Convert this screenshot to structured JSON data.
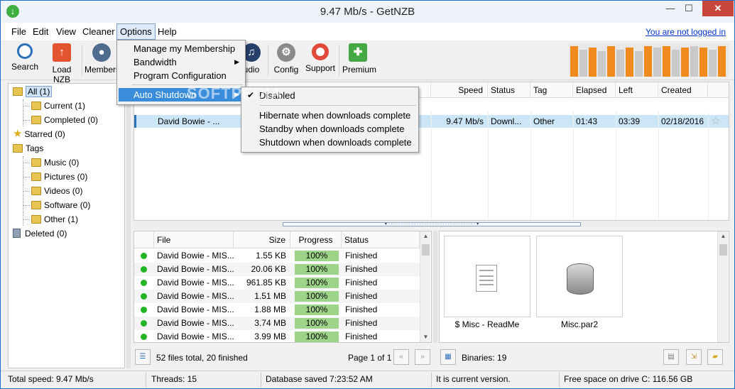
{
  "window": {
    "title": "9.47 Mb/s - GetNZB",
    "colors": {
      "titlebar": "#eef3fa",
      "close": "#c7463c",
      "accent": "#3a8ddb"
    }
  },
  "menubar": {
    "items": [
      "File",
      "Edit",
      "View",
      "Cleaner",
      "Options",
      "Help"
    ],
    "login_link": "You are not logged in"
  },
  "toolbar": {
    "buttons": [
      {
        "label": "Search",
        "icon": "magnifier-icon"
      },
      {
        "label": "Load NZB",
        "icon": "upload-icon"
      },
      {
        "label": "Members",
        "icon": "member-icon"
      },
      {
        "label": "udio",
        "icon": "audio-icon"
      },
      {
        "label": "Config",
        "icon": "gear-icon"
      },
      {
        "label": "Support",
        "icon": "lifebuoy-icon"
      },
      {
        "label": "Premium",
        "icon": "gift-icon"
      }
    ],
    "speed_meter_levels": [
      0.95,
      0.85,
      0.9,
      0.8,
      0.95,
      0.85,
      0.9,
      0.8,
      0.95,
      0.9,
      0.95,
      0.85,
      0.9,
      0.95,
      0.9,
      0.85,
      0.95
    ]
  },
  "options_menu": {
    "items": [
      {
        "label": "Manage my Membership",
        "submenu": false
      },
      {
        "label": "Bandwidth",
        "submenu": true
      },
      {
        "label": "Program Configuration",
        "submenu": false
      },
      {
        "label": "Auto Shutdown",
        "submenu": true,
        "highlighted": true
      }
    ]
  },
  "shutdown_submenu": {
    "items": [
      {
        "label": "Disabled",
        "checked": true
      },
      {
        "label": "Hibernate when downloads complete",
        "checked": false
      },
      {
        "label": "Standby when downloads complete",
        "checked": false
      },
      {
        "label": "Shutdown when downloads complete",
        "checked": false
      }
    ]
  },
  "watermark": "SOFTPEDIA",
  "tree": {
    "all": "All (1)",
    "current": "Current (1)",
    "completed": "Completed (0)",
    "starred": "Starred (0)",
    "tags": "Tags",
    "music": "Music (0)",
    "pictures": "Pictures (0)",
    "videos": "Videos (0)",
    "software": "Software (0)",
    "other": "Other (1)",
    "deleted": "Deleted (0)"
  },
  "downloads": {
    "columns": [
      "Speed",
      "Status",
      "Tag",
      "Elapsed",
      "Left",
      "Created"
    ],
    "row": {
      "name": "David Bowie - ...",
      "speed": "9.47 Mb/s",
      "status": "Downl...",
      "tag": "Other",
      "elapsed": "01:43",
      "left": "03:39",
      "created": "02/18/2016"
    }
  },
  "files": {
    "columns": [
      "File",
      "Size",
      "Progress",
      "Status"
    ],
    "rows": [
      {
        "name": "David Bowie - MIS...",
        "size": "1.55 KB",
        "progress": "100%",
        "status": "Finished"
      },
      {
        "name": "David Bowie - MIS...",
        "size": "20.06 KB",
        "progress": "100%",
        "status": "Finished"
      },
      {
        "name": "David Bowie - MIS...",
        "size": "961.85 KB",
        "progress": "100%",
        "status": "Finished"
      },
      {
        "name": "David Bowie - MIS...",
        "size": "1.51 MB",
        "progress": "100%",
        "status": "Finished"
      },
      {
        "name": "David Bowie - MIS...",
        "size": "1.88 MB",
        "progress": "100%",
        "status": "Finished"
      },
      {
        "name": "David Bowie - MIS...",
        "size": "3.74 MB",
        "progress": "100%",
        "status": "Finished"
      },
      {
        "name": "David Bowie - MIS...",
        "size": "3.99 MB",
        "progress": "100%",
        "status": "Finished"
      }
    ],
    "summary": "52 files total, 20 finished",
    "page": "Page 1 of 1",
    "prev": "«",
    "next": "»"
  },
  "binaries": {
    "tiles": [
      {
        "label": "$ Misc - ReadMe",
        "icon": "text-file-icon"
      },
      {
        "label": "Misc.par2",
        "icon": "database-icon"
      }
    ],
    "count": "Binaries: 19"
  },
  "statusbar": {
    "total_speed": "Total speed: 9.47 Mb/s",
    "threads": "Threads: 15",
    "database": "Database saved 7:23:52 AM",
    "version": "It is current version.",
    "free_space": "Free space on drive C: 116.56 GB"
  }
}
